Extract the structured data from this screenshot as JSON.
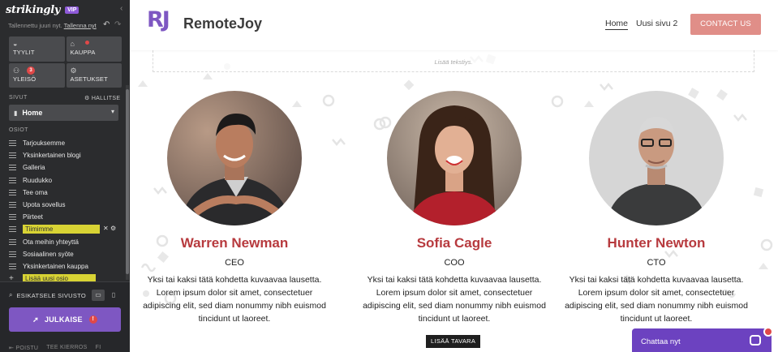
{
  "editor": {
    "logo": "strikingly",
    "vip_label": "VIP",
    "save_status": "Tallennettu juuri nyt.",
    "save_link": "Tallenna nyt",
    "tiles": [
      {
        "label": "TYYLIT",
        "icon": "palette-icon"
      },
      {
        "label": "KAUPPA",
        "icon": "store-icon"
      },
      {
        "label": "YLEISÖ",
        "icon": "audience-icon",
        "badge": "3"
      },
      {
        "label": "ASETUKSET",
        "icon": "gear-icon"
      }
    ],
    "pages_heading": "SIVUT",
    "manage_label": "HALLITSE",
    "current_page": "Home",
    "sections_heading": "OSIOT",
    "sections": [
      "Tarjouksemme",
      "Yksinkertainen blogi",
      "Galleria",
      "Ruudukko",
      "Tee oma",
      "Upota sovellus",
      "Piirteet",
      "Tiimimme",
      "Ota meihin yhteyttä",
      "Sosiaalinen syöte",
      "Yksinkertainen kauppa"
    ],
    "active_section_index": 7,
    "add_section": "Lisää uusi osio",
    "preview_label": "ESIKATSELE SIVUSTO",
    "publish_label": "JULKAISE",
    "footer_links": [
      "POISTU",
      "TEE KIERROS",
      "FI"
    ]
  },
  "site": {
    "brand_mark": "RJ",
    "brand_name": "RemoteJoy",
    "nav": [
      "Home",
      "Uusi sivu 2"
    ],
    "contact_label": "CONTACT US",
    "textbox_placeholder": "Lisää tekstiys.",
    "team": [
      {
        "name": "Warren Newman",
        "role": "CEO",
        "bio": "Yksi tai kaksi tätä kohdetta kuvaavaa lausetta. Lorem ipsum dolor sit amet, consectetuer adipiscing elit, sed diam nonummy nibh euismod tincidunt ut laoreet."
      },
      {
        "name": "Sofia Cagle",
        "role": "COO",
        "bio": "Yksi tai kaksi tätä kohdetta kuvaavaa lausetta. Lorem ipsum dolor sit amet, consectetuer adipiscing elit, sed diam nonummy nibh euismod tincidunt ut laoreet."
      },
      {
        "name": "Hunter Newton",
        "role": "CTO",
        "bio": "Yksi tai kaksi tätä kohdetta kuvaavaa lausetta. Lorem ipsum dolor sit amet, consectetuer adipiscing elit, sed diam nonummy nibh euismod tincidunt ut laoreet."
      }
    ],
    "add_item_label": "LISÄÄ TAVARA",
    "chat_label": "Chattaa nyt"
  },
  "colors": {
    "sidebar_bg": "#2b2c2e",
    "accent_purple": "#7e57c2",
    "name_red": "#b73a3e",
    "contact_pink": "#e08e88",
    "highlight_yellow": "#d8d334"
  }
}
